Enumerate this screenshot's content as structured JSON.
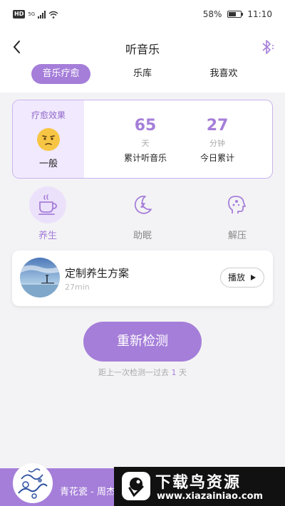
{
  "status_bar": {
    "left_badge": "HD",
    "network": "5G",
    "battery": "58%",
    "time": "11:10",
    "battery_level": 0.58
  },
  "header": {
    "title": "听音乐"
  },
  "tabs": [
    {
      "label": "音乐疗愈",
      "active": true
    },
    {
      "label": "乐库",
      "active": false
    },
    {
      "label": "我喜欢",
      "active": false
    }
  ],
  "effect": {
    "label": "疗愈效果",
    "value": "一般",
    "stats": [
      {
        "num": "65",
        "unit": "天",
        "desc": "累计听音乐"
      },
      {
        "num": "27",
        "unit": "分钟",
        "desc": "今日累计"
      }
    ]
  },
  "categories": [
    {
      "label": "养生",
      "icon": "tea-cup-icon",
      "active": true
    },
    {
      "label": "助眠",
      "icon": "moon-sleep-icon",
      "active": false
    },
    {
      "label": "解压",
      "icon": "head-relax-icon",
      "active": false
    }
  ],
  "plan": {
    "title": "定制养生方案",
    "duration": "27min",
    "play_label": "播放"
  },
  "retest": {
    "button_label": "重新检测",
    "last_check_prefix": "距上一次检测一过去",
    "last_check_days": "1",
    "last_check_suffix": "天"
  },
  "player": {
    "song": "青花瓷 - 周杰伦"
  },
  "watermark": {
    "title": "下载鸟资源",
    "url": "www.xiazainiao.com"
  },
  "colors": {
    "accent": "#a57ed9",
    "accent_light": "#f1e9fd",
    "background": "#f3f3f5"
  }
}
